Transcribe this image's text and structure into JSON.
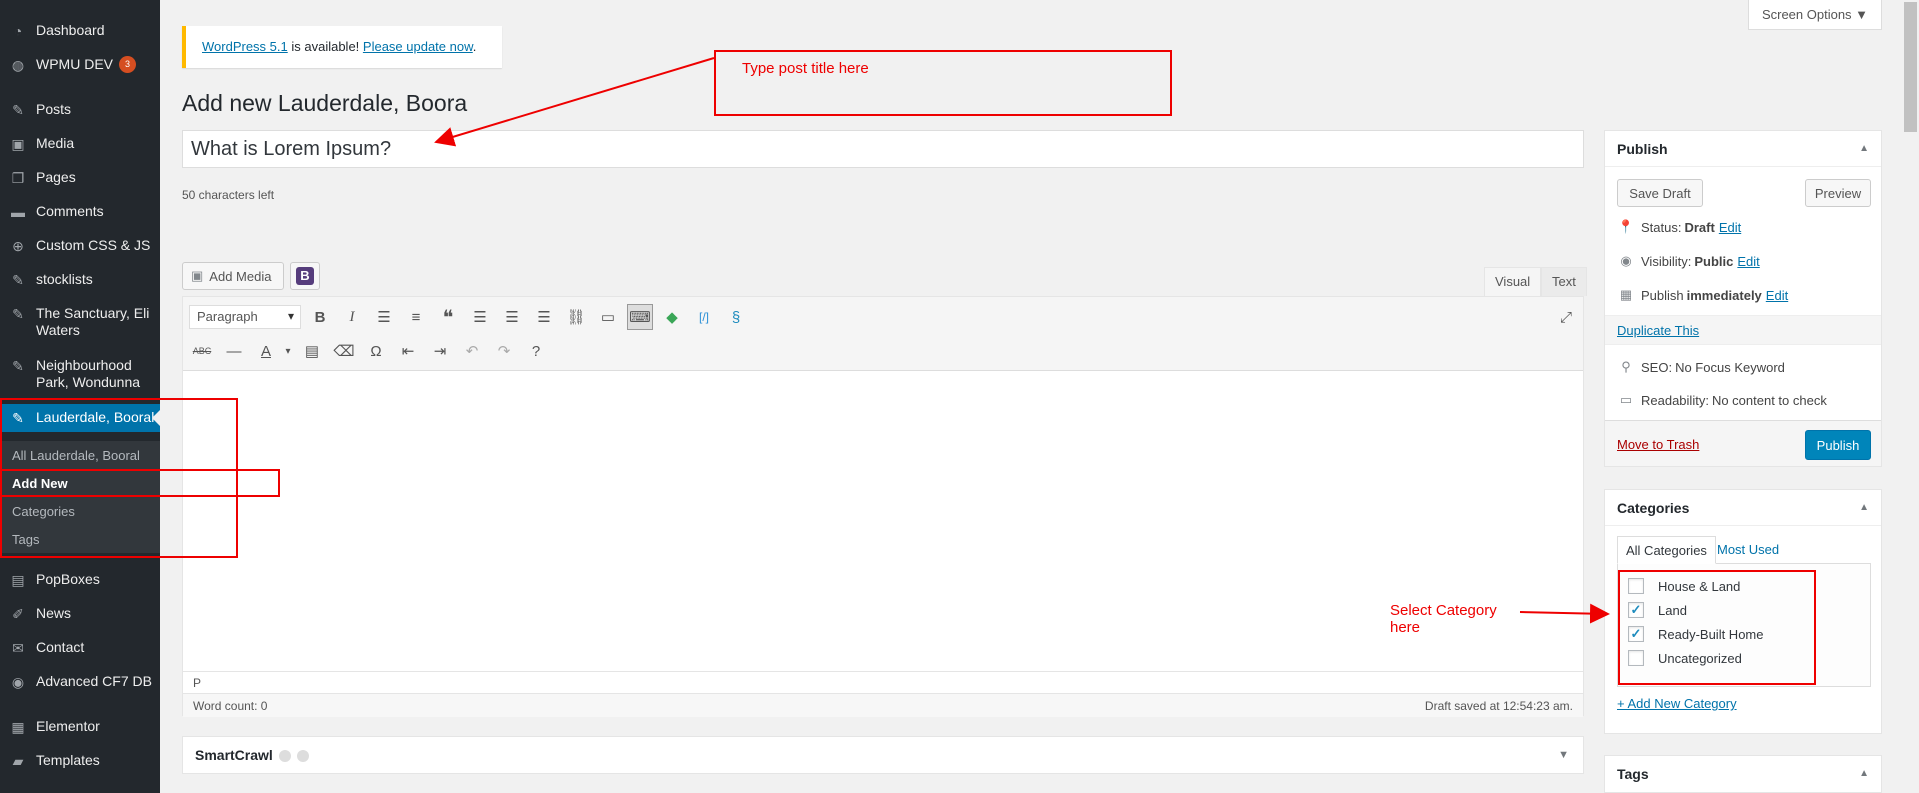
{
  "sidebar": {
    "items": [
      {
        "label": "Dashboard",
        "icon": "dashboard-icon"
      },
      {
        "label": "WPMU DEV",
        "icon": "wpmudev-icon",
        "badge": "3"
      },
      {
        "label": "Posts",
        "icon": "pin-icon"
      },
      {
        "label": "Media",
        "icon": "media-icon"
      },
      {
        "label": "Pages",
        "icon": "pages-icon"
      },
      {
        "label": "Comments",
        "icon": "comments-icon"
      },
      {
        "label": "Custom CSS & JS",
        "icon": "plus-circle-icon"
      },
      {
        "label": "stocklists",
        "icon": "pin-icon"
      },
      {
        "label": "The Sanctuary, Eli",
        "label2": "Waters",
        "icon": "pin-icon"
      },
      {
        "label": "Neighbourhood",
        "label2": "Park, Wondunna",
        "icon": "pin-icon"
      },
      {
        "label": "Lauderdale, Booral",
        "icon": "pin-icon"
      },
      {
        "label": "PopBoxes",
        "icon": "popboxes-icon"
      },
      {
        "label": "News",
        "icon": "news-icon"
      },
      {
        "label": "Contact",
        "icon": "mail-icon"
      },
      {
        "label": "Advanced CF7 DB",
        "icon": "eye-icon"
      },
      {
        "label": "Elementor",
        "icon": "elementor-icon"
      },
      {
        "label": "Templates",
        "icon": "folder-icon"
      }
    ],
    "submenu": [
      "All Lauderdale, Booral",
      "Add New",
      "Categories",
      "Tags"
    ]
  },
  "notice": {
    "link1": "WordPress 5.1",
    "text": " is available! ",
    "link2": "Please update now",
    "end": "."
  },
  "screen_options": "Screen Options ▼",
  "page_title": "Add new Lauderdale, Boora",
  "title_input": {
    "value": "What is Lorem Ipsum?"
  },
  "chars_left": "50 characters left",
  "editor": {
    "add_media": "Add Media",
    "b_button": "B",
    "tabs": [
      "Visual",
      "Text"
    ],
    "format_select": "Paragraph",
    "path": "P",
    "word_count": "Word count: 0",
    "draft_saved": "Draft saved at 12:54:23 am."
  },
  "smartcrawl": {
    "title": "SmartCrawl"
  },
  "publish": {
    "title": "Publish",
    "save_draft": "Save Draft",
    "preview": "Preview",
    "status_label": "Status:",
    "status_value": "Draft",
    "visibility_label": "Visibility:",
    "visibility_value": "Public",
    "publish_label": "Publish",
    "publish_value": "immediately",
    "edit": "Edit",
    "duplicate": "Duplicate This",
    "seo_label": "SEO:",
    "seo_value": "No Focus Keyword",
    "readability_label": "Readability:",
    "readability_value": "No content to check",
    "trash": "Move to Trash",
    "publish_button": "Publish"
  },
  "categories": {
    "title": "Categories",
    "tabs": [
      "All Categories",
      "Most Used"
    ],
    "items": [
      {
        "label": "House & Land",
        "checked": false
      },
      {
        "label": "Land",
        "checked": true
      },
      {
        "label": "Ready-Built Home",
        "checked": true
      },
      {
        "label": "Uncategorized",
        "checked": false
      }
    ],
    "add_new": "+ Add New Category"
  },
  "tags": {
    "title": "Tags"
  },
  "annotations": {
    "title_hint": "Type post title here",
    "category_hint_line1": "Select Category",
    "category_hint_line2": "here"
  },
  "colors": {
    "sidebar": "#23282d",
    "active": "#0073aa",
    "annotation": "#ee0000",
    "primary_button": "#0085ba"
  }
}
